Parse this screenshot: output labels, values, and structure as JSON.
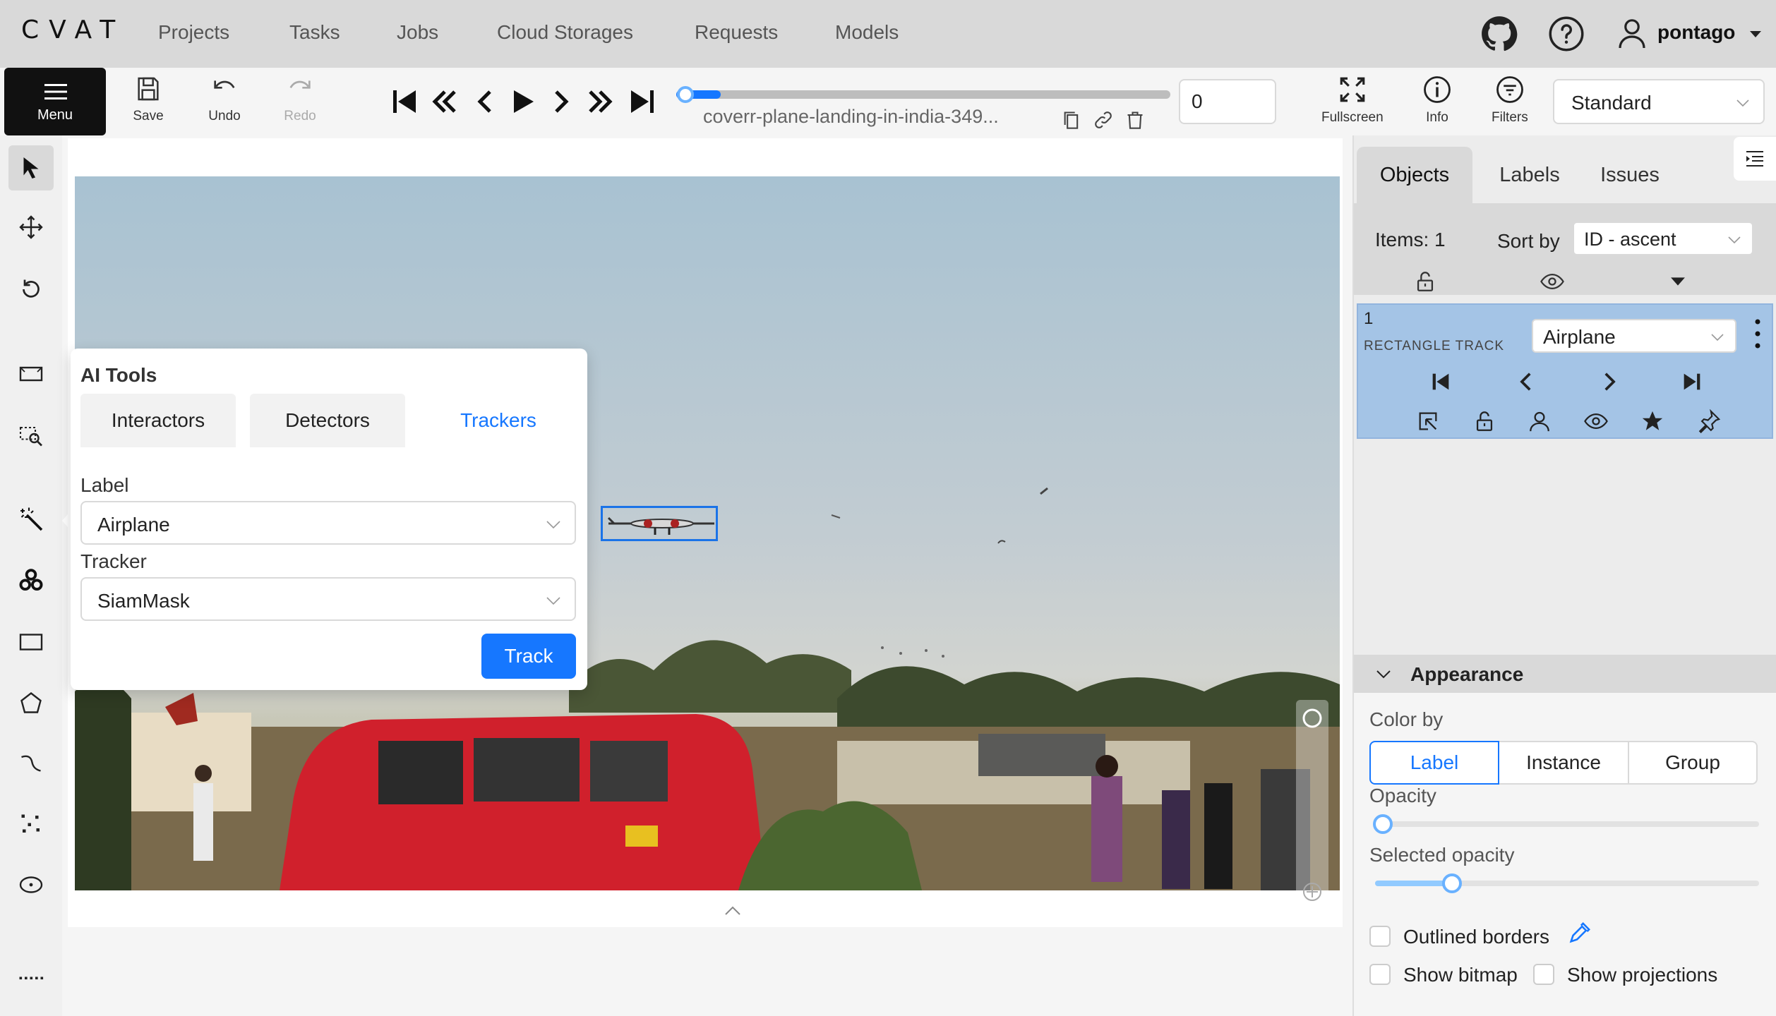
{
  "app": {
    "logo": "CVAT"
  },
  "nav": {
    "items": [
      "Projects",
      "Tasks",
      "Jobs",
      "Cloud Storages",
      "Requests",
      "Models"
    ],
    "username": "pontago"
  },
  "toolbar": {
    "menu_label": "Menu",
    "save_label": "Save",
    "undo_label": "Undo",
    "redo_label": "Redo",
    "filename": "coverr-plane-landing-in-india-349...",
    "frame_value": "0",
    "fullscreen_label": "Fullscreen",
    "info_label": "Info",
    "filters_label": "Filters",
    "workspace": "Standard",
    "progress_fraction": 0.09
  },
  "ai_tools": {
    "title": "AI Tools",
    "tabs": [
      "Interactors",
      "Detectors",
      "Trackers"
    ],
    "active_tab": "Trackers",
    "label_title": "Label",
    "label_value": "Airplane",
    "tracker_title": "Tracker",
    "tracker_value": "SiamMask",
    "track_button": "Track"
  },
  "sidebar": {
    "tabs": [
      "Objects",
      "Labels",
      "Issues"
    ],
    "active_tab": "Objects",
    "items_count": "Items: 1",
    "sort_label": "Sort by",
    "sort_value": "ID - ascent",
    "object": {
      "id": "1",
      "type": "RECTANGLE TRACK",
      "label": "Airplane",
      "color": "#a4c4e6"
    },
    "appearance": {
      "title": "Appearance",
      "color_by_label": "Color by",
      "color_by_options": [
        "Label",
        "Instance",
        "Group"
      ],
      "color_by_selected": "Label",
      "opacity_label": "Opacity",
      "opacity_value": 0.02,
      "selected_opacity_label": "Selected opacity",
      "selected_opacity_value": 0.2,
      "outlined_borders_label": "Outlined borders",
      "show_bitmap_label": "Show bitmap",
      "show_projections_label": "Show projections"
    }
  },
  "colors": {
    "accent": "#1677ff",
    "object_card": "#a4c4e6",
    "bbox": "#1a73e8"
  }
}
